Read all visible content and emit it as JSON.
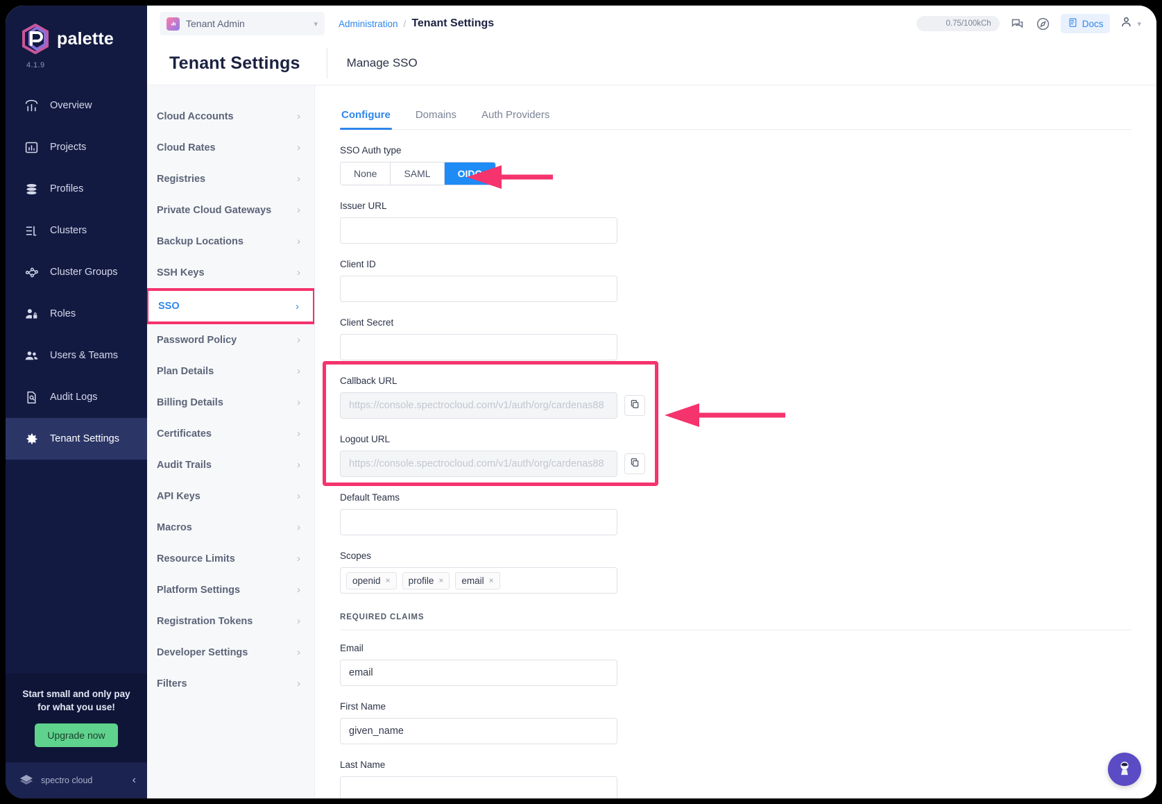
{
  "brand": {
    "name": "palette",
    "version": "4.1.9",
    "footer_name": "spectro cloud"
  },
  "sidebar": {
    "items": [
      {
        "label": "Overview",
        "icon": "chart-overview-icon"
      },
      {
        "label": "Projects",
        "icon": "bar-chart-icon"
      },
      {
        "label": "Profiles",
        "icon": "layers-stack-icon"
      },
      {
        "label": "Clusters",
        "icon": "list-panel-icon"
      },
      {
        "label": "Cluster Groups",
        "icon": "nodes-graph-icon"
      },
      {
        "label": "Roles",
        "icon": "user-lock-icon"
      },
      {
        "label": "Users & Teams",
        "icon": "users-icon"
      },
      {
        "label": "Audit Logs",
        "icon": "document-search-icon"
      },
      {
        "label": "Tenant Settings",
        "icon": "gear-icon"
      }
    ],
    "active_index": 8,
    "promo": {
      "line1": "Start small and only pay",
      "line2": "for what you use!",
      "button": "Upgrade now"
    },
    "collapse_icon": "chevron-left-icon"
  },
  "topbar": {
    "tenant_selector": "Tenant Admin",
    "breadcrumb": {
      "parent": "Administration",
      "separator": "/",
      "current": "Tenant Settings"
    },
    "usage_pill": "0.75/100kCh",
    "chat_icon": "chat-bubbles-icon",
    "compass_icon": "compass-icon",
    "docs_label": "Docs",
    "docs_icon": "book-icon",
    "user_icon": "user-avatar-icon",
    "user_caret": "chevron-down-icon"
  },
  "page": {
    "title": "Tenant Settings",
    "subtitle": "Manage SSO"
  },
  "submenu": {
    "items": [
      {
        "label": "Cloud Accounts"
      },
      {
        "label": "Cloud Rates"
      },
      {
        "label": "Registries"
      },
      {
        "label": "Private Cloud Gateways"
      },
      {
        "label": "Backup Locations"
      },
      {
        "label": "SSH Keys"
      },
      {
        "label": "SSO"
      },
      {
        "label": "Password Policy"
      },
      {
        "label": "Plan Details"
      },
      {
        "label": "Billing Details"
      },
      {
        "label": "Certificates"
      },
      {
        "label": "Audit Trails"
      },
      {
        "label": "API Keys"
      },
      {
        "label": "Macros"
      },
      {
        "label": "Resource Limits"
      },
      {
        "label": "Platform Settings"
      },
      {
        "label": "Registration Tokens"
      },
      {
        "label": "Developer Settings"
      },
      {
        "label": "Filters"
      }
    ],
    "selected_index": 6,
    "chevron": "›"
  },
  "main": {
    "tabs": [
      {
        "label": "Configure"
      },
      {
        "label": "Domains"
      },
      {
        "label": "Auth Providers"
      }
    ],
    "active_tab_index": 0,
    "auth_type": {
      "label": "SSO Auth type",
      "options": [
        "None",
        "SAML",
        "OIDC"
      ],
      "selected": "OIDC"
    },
    "fields": {
      "issuer_url": {
        "label": "Issuer URL",
        "value": "",
        "placeholder": ""
      },
      "client_id": {
        "label": "Client ID",
        "value": "",
        "placeholder": ""
      },
      "client_secret": {
        "label": "Client Secret",
        "value": "",
        "placeholder": ""
      },
      "callback_url": {
        "label": "Callback URL",
        "value": "",
        "placeholder": "https://console.spectrocloud.com/v1/auth/org/cardenas88",
        "readonly": true
      },
      "logout_url": {
        "label": "Logout URL",
        "value": "",
        "placeholder": "https://console.spectrocloud.com/v1/auth/org/cardenas88",
        "readonly": true
      },
      "default_teams": {
        "label": "Default Teams",
        "value": "",
        "placeholder": ""
      }
    },
    "scopes": {
      "label": "Scopes",
      "tags": [
        "openid",
        "profile",
        "email"
      ],
      "remove_icon": "×"
    },
    "required_claims": {
      "heading": "REQUIRED CLAIMS",
      "fields": [
        {
          "label": "Email",
          "value": "email"
        },
        {
          "label": "First Name",
          "value": "given_name"
        },
        {
          "label": "Last Name",
          "value": ""
        }
      ]
    },
    "copy_icon": "copy-icon"
  },
  "annotations": {
    "highlight_color": "#f5336c",
    "sso_menu_highlight": true,
    "urls_highlight": true,
    "arrow_to_oidc": true,
    "arrow_to_urls": true
  },
  "fab": {
    "icon": "astronaut-icon",
    "color": "#5b4bc4"
  }
}
